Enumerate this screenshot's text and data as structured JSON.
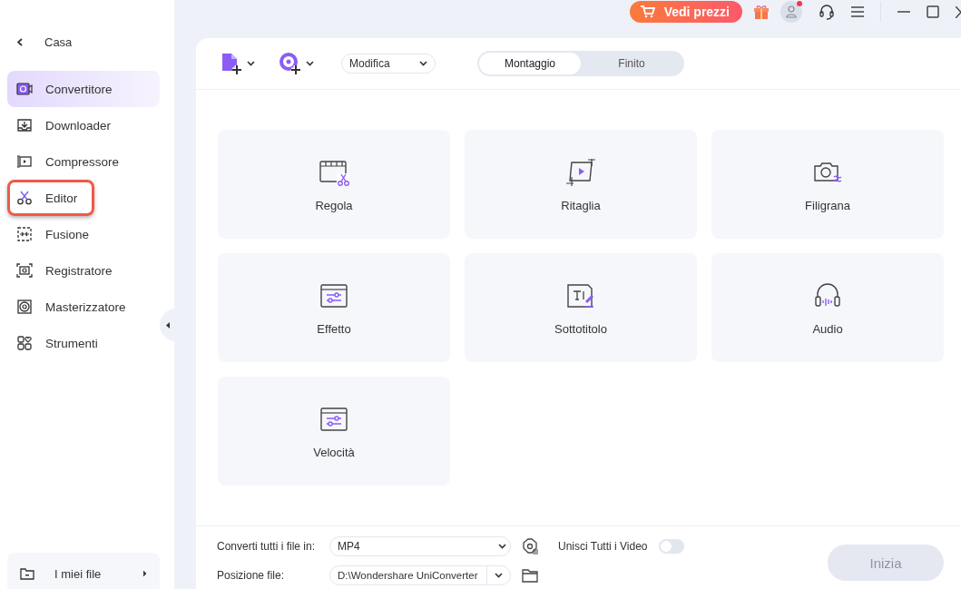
{
  "sidebar": {
    "home": {
      "label": "Casa"
    },
    "items": [
      {
        "label": "Convertitore",
        "selected": true,
        "annotated": false
      },
      {
        "label": "Downloader",
        "selected": false,
        "annotated": false
      },
      {
        "label": "Compressore",
        "selected": false,
        "annotated": false
      },
      {
        "label": "Editor",
        "selected": false,
        "annotated": true
      },
      {
        "label": "Fusione",
        "selected": false,
        "annotated": false
      },
      {
        "label": "Registratore",
        "selected": false,
        "annotated": false
      },
      {
        "label": "Masterizzatore",
        "selected": false,
        "annotated": false
      },
      {
        "label": "Strumenti",
        "selected": false,
        "annotated": false
      }
    ],
    "footer": {
      "label": "I miei file"
    }
  },
  "topbar": {
    "price_button": "Vedi prezzi",
    "notification": true
  },
  "toolbar": {
    "mode_select": "Modifica",
    "tabs": [
      {
        "label": "Montaggio",
        "selected": true
      },
      {
        "label": "Finito",
        "selected": false
      }
    ]
  },
  "tools": [
    {
      "label": "Regola"
    },
    {
      "label": "Ritaglia"
    },
    {
      "label": "Filigrana"
    },
    {
      "label": "Effetto"
    },
    {
      "label": "Sottotitolo"
    },
    {
      "label": "Audio"
    },
    {
      "label": "Velocità"
    }
  ],
  "bottom": {
    "format_label": "Converti tutti i file in:",
    "format_value": "MP4",
    "merge_label": "Unisci Tutti i Video",
    "merge_on": false,
    "location_label": "Posizione file:",
    "location_value": "D:\\Wondershare UniConverter",
    "start_button": "Inizia",
    "start_disabled": true
  }
}
